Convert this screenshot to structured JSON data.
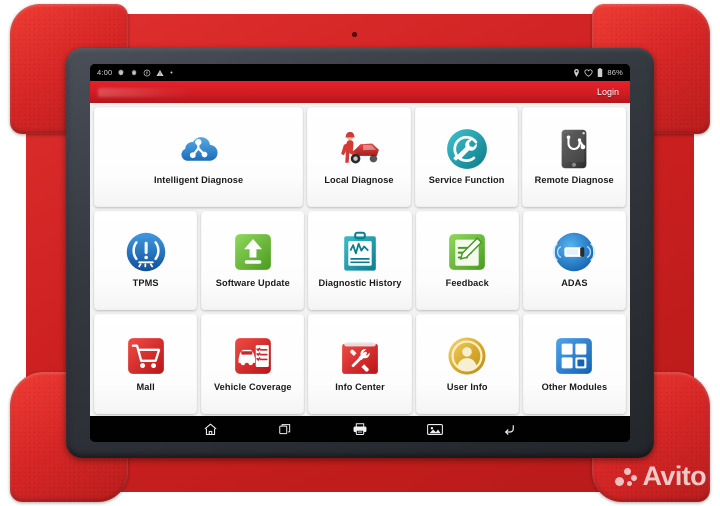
{
  "device": {
    "name": "automotive-diagnostic-tablet",
    "bumper_color": "#d52525",
    "bezel_color": "#34383f"
  },
  "statusbar": {
    "time": "4:00",
    "left_icons": [
      "gear-icon",
      "gear-icon",
      "circle-badge-icon",
      "warning-triangle-icon",
      "dot-icon"
    ],
    "right_icons": [
      "location-pin-icon",
      "heart-icon",
      "battery-icon"
    ],
    "battery_label": "86%"
  },
  "app_header": {
    "login_label": "Login",
    "background_color": "#d11c22"
  },
  "home_grid": {
    "rows": [
      [
        {
          "label": "Intelligent Diagnose",
          "icon": "cloud-network-icon",
          "color": "#2f86d4",
          "wide": true
        },
        {
          "label": "Local Diagnose",
          "icon": "mechanic-car-icon",
          "color": "#cf2a2a",
          "wide": false
        },
        {
          "label": "Service Function",
          "icon": "wrench-refresh-icon",
          "color": "#18939f",
          "wide": false
        },
        {
          "label": "Remote Diagnose",
          "icon": "tablet-stethoscope-icon",
          "color": "#4a4a4a",
          "wide": false
        }
      ],
      [
        {
          "label": "TPMS",
          "icon": "tire-pressure-icon",
          "color": "#1c6fc4",
          "wide": false
        },
        {
          "label": "Software Update",
          "icon": "upload-arrow-icon",
          "color": "#6cba3a",
          "wide": false
        },
        {
          "label": "Diagnostic History",
          "icon": "clipboard-waveform-icon",
          "color": "#1b96a8",
          "wide": false
        },
        {
          "label": "Feedback",
          "icon": "document-pencil-icon",
          "color": "#6cba3a",
          "wide": false
        },
        {
          "label": "ADAS",
          "icon": "car-radar-icon",
          "color": "#1d7fd4",
          "wide": false
        }
      ],
      [
        {
          "label": "Mall",
          "icon": "shopping-cart-icon",
          "color": "#d8232a",
          "wide": false
        },
        {
          "label": "Vehicle Coverage",
          "icon": "car-checklist-icon",
          "color": "#d8232a",
          "wide": false
        },
        {
          "label": "Info Center",
          "icon": "tools-folder-icon",
          "color": "#d8232a",
          "wide": false
        },
        {
          "label": "User Info",
          "icon": "user-coin-icon",
          "color": "#e0b43a",
          "wide": false
        },
        {
          "label": "Other Modules",
          "icon": "grid-squares-icon",
          "color": "#2683d6",
          "wide": false
        }
      ]
    ]
  },
  "navbar": {
    "buttons": [
      {
        "name": "home-icon",
        "label": "Home"
      },
      {
        "name": "recent-apps-icon",
        "label": "Recent apps"
      },
      {
        "name": "printer-icon",
        "label": "Print"
      },
      {
        "name": "screenshot-image-icon",
        "label": "Gallery"
      },
      {
        "name": "back-arrow-icon",
        "label": "Back"
      }
    ]
  },
  "watermark": {
    "text": "Avito"
  }
}
